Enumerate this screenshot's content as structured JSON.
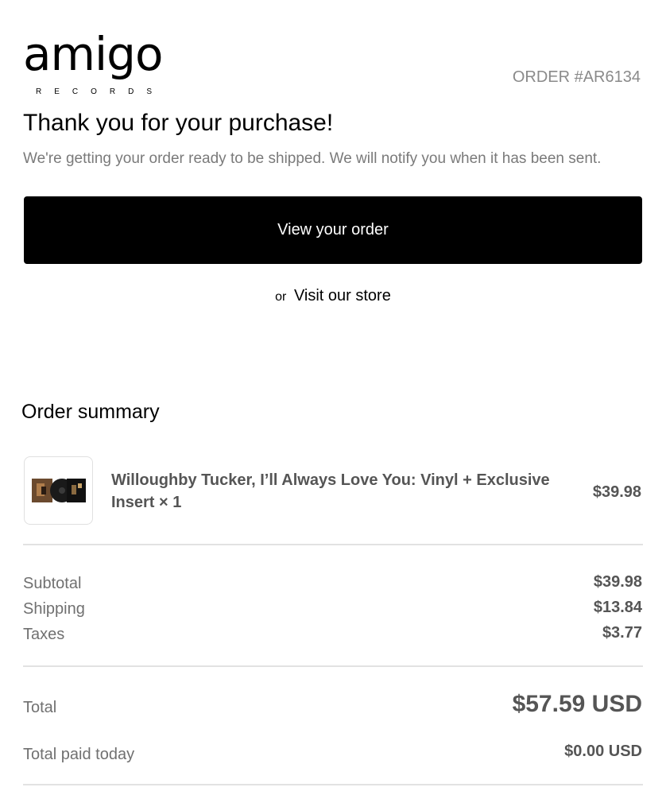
{
  "brand": {
    "name": "amigo",
    "sub": "RECORDS"
  },
  "order": {
    "number": "ORDER #AR6134"
  },
  "headline": "Thank you for your purchase!",
  "subline": "We're getting your order ready to be shipped. We will notify you when it has been sent.",
  "actions": {
    "view_order": "View your order",
    "or": "or",
    "visit_store": "Visit our store"
  },
  "summary": {
    "title": "Order summary",
    "items": [
      {
        "name": "Willoughby Tucker, I’ll Always Love You: Vinyl + Exclusive Insert × 1",
        "price": "$39.98",
        "thumbnail": "album-vinyl-image"
      }
    ],
    "subtotal_label": "Subtotal",
    "subtotal": "$39.98",
    "shipping_label": "Shipping",
    "shipping": "$13.84",
    "taxes_label": "Taxes",
    "taxes": "$3.77",
    "total_label": "Total",
    "total": "$57.59 USD",
    "paid_label": "Total paid today",
    "paid": "$0.00 USD"
  },
  "colors": {
    "button_bg": "#000000",
    "muted_text": "#7a7a7a",
    "value_text": "#555555",
    "divider": "#e2e2e2"
  }
}
